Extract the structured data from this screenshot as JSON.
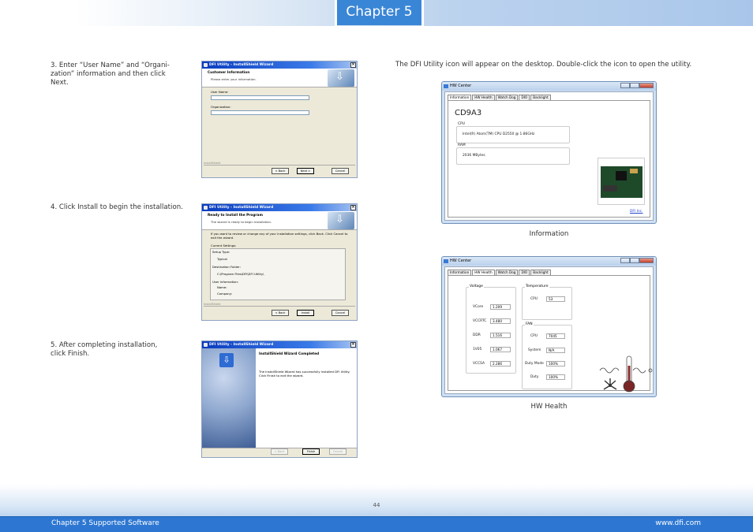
{
  "header": {
    "chapter": "Chapter 5"
  },
  "steps": {
    "s3": "3. Enter “User Name” and “Organi-\n    zation” information and then click\n    Next.",
    "s4": "4. Click Install to begin the installation.",
    "s5": "5. After completing installation,\n    click Finish.",
    "intro": "The DFI Utility icon will appear on the desktop. Double-click the icon to open the utility."
  },
  "wizard1": {
    "title": "DFI Utility - InstallShield Wizard",
    "heading": "Customer Information",
    "sub": "Please enter your information.",
    "user_label": "User Name:",
    "org_label": "Organization:",
    "brand": "InstallShield",
    "back": "< Back",
    "next": "Next >",
    "cancel": "Cancel"
  },
  "wizard2": {
    "title": "DFI Utility - InstallShield Wizard",
    "heading": "Ready to Install the Program",
    "sub": "The wizard is ready to begin installation.",
    "desc": "If you want to review or change any of your installation settings, click Back. Click Cancel to exit the wizard.",
    "current": "Current Settings:",
    "setup_type": "Setup Type:",
    "typical": "Typical",
    "dest": "Destination Folder:",
    "dest_path": "C:\\Program Files\\DFI\\DFI Utility\\",
    "userinfo": "User Information:",
    "name": "Name:",
    "company": "Company:",
    "brand": "InstallShield",
    "back": "< Back",
    "install": "Install",
    "cancel": "Cancel"
  },
  "wizard3": {
    "title": "DFI Utility - InstallShield Wizard",
    "heading": "InstallShield Wizard Completed",
    "desc": "The InstallShield Wizard has successfully installed DFI Utility. Click Finish to exit the wizard.",
    "back": "< Back",
    "finish": "Finish",
    "cancel": "Cancel"
  },
  "hwinfo": {
    "title": "HW Center",
    "tabs": [
      "Information",
      "HW Health",
      "Watch Dog",
      "DIO",
      "Backlight"
    ],
    "model": "CD9A3",
    "cpu_label": "CPU",
    "cpu_value": "Intel(R) Atom(TM) CPU D2550  @ 1.86GHz",
    "ram_label": "RAM",
    "ram_value": "2036 MBytes",
    "link": "DFI Inc.",
    "caption": "Information"
  },
  "hwhealth": {
    "title": "HW Center",
    "tabs": [
      "Information",
      "HW Health",
      "Watch Dog",
      "DIO",
      "Backlight"
    ],
    "voltage_label": "Voltage",
    "voltages": [
      {
        "name": "VCore",
        "value": "1.209"
      },
      {
        "name": "VCCRTC",
        "value": "3.480"
      },
      {
        "name": "DDR",
        "value": "1.516"
      },
      {
        "name": "1V05",
        "value": "1.067"
      },
      {
        "name": "VCCSA",
        "value": "2.286"
      }
    ],
    "temp_label": "Temperature",
    "temp_cpu_name": "CPU",
    "temp_cpu_value": "53",
    "fan_label": "FAN",
    "fans": [
      {
        "name": "CPU",
        "value": "7045"
      },
      {
        "name": "System",
        "value": "N/A"
      },
      {
        "name": "Duty Mode",
        "value": "100%"
      },
      {
        "name": "Duty",
        "value": "100%"
      }
    ],
    "caption": "HW Health"
  },
  "footer": {
    "page": "44",
    "left": "Chapter 5 Supported Software",
    "right": "www.dfi.com"
  },
  "colors": {
    "accent": "#2d77d2",
    "tab": "#3a86d6"
  },
  "icons": [
    "thermometer-icon",
    "fan-icon",
    "installshield-logo-icon",
    "window-close-icon"
  ]
}
